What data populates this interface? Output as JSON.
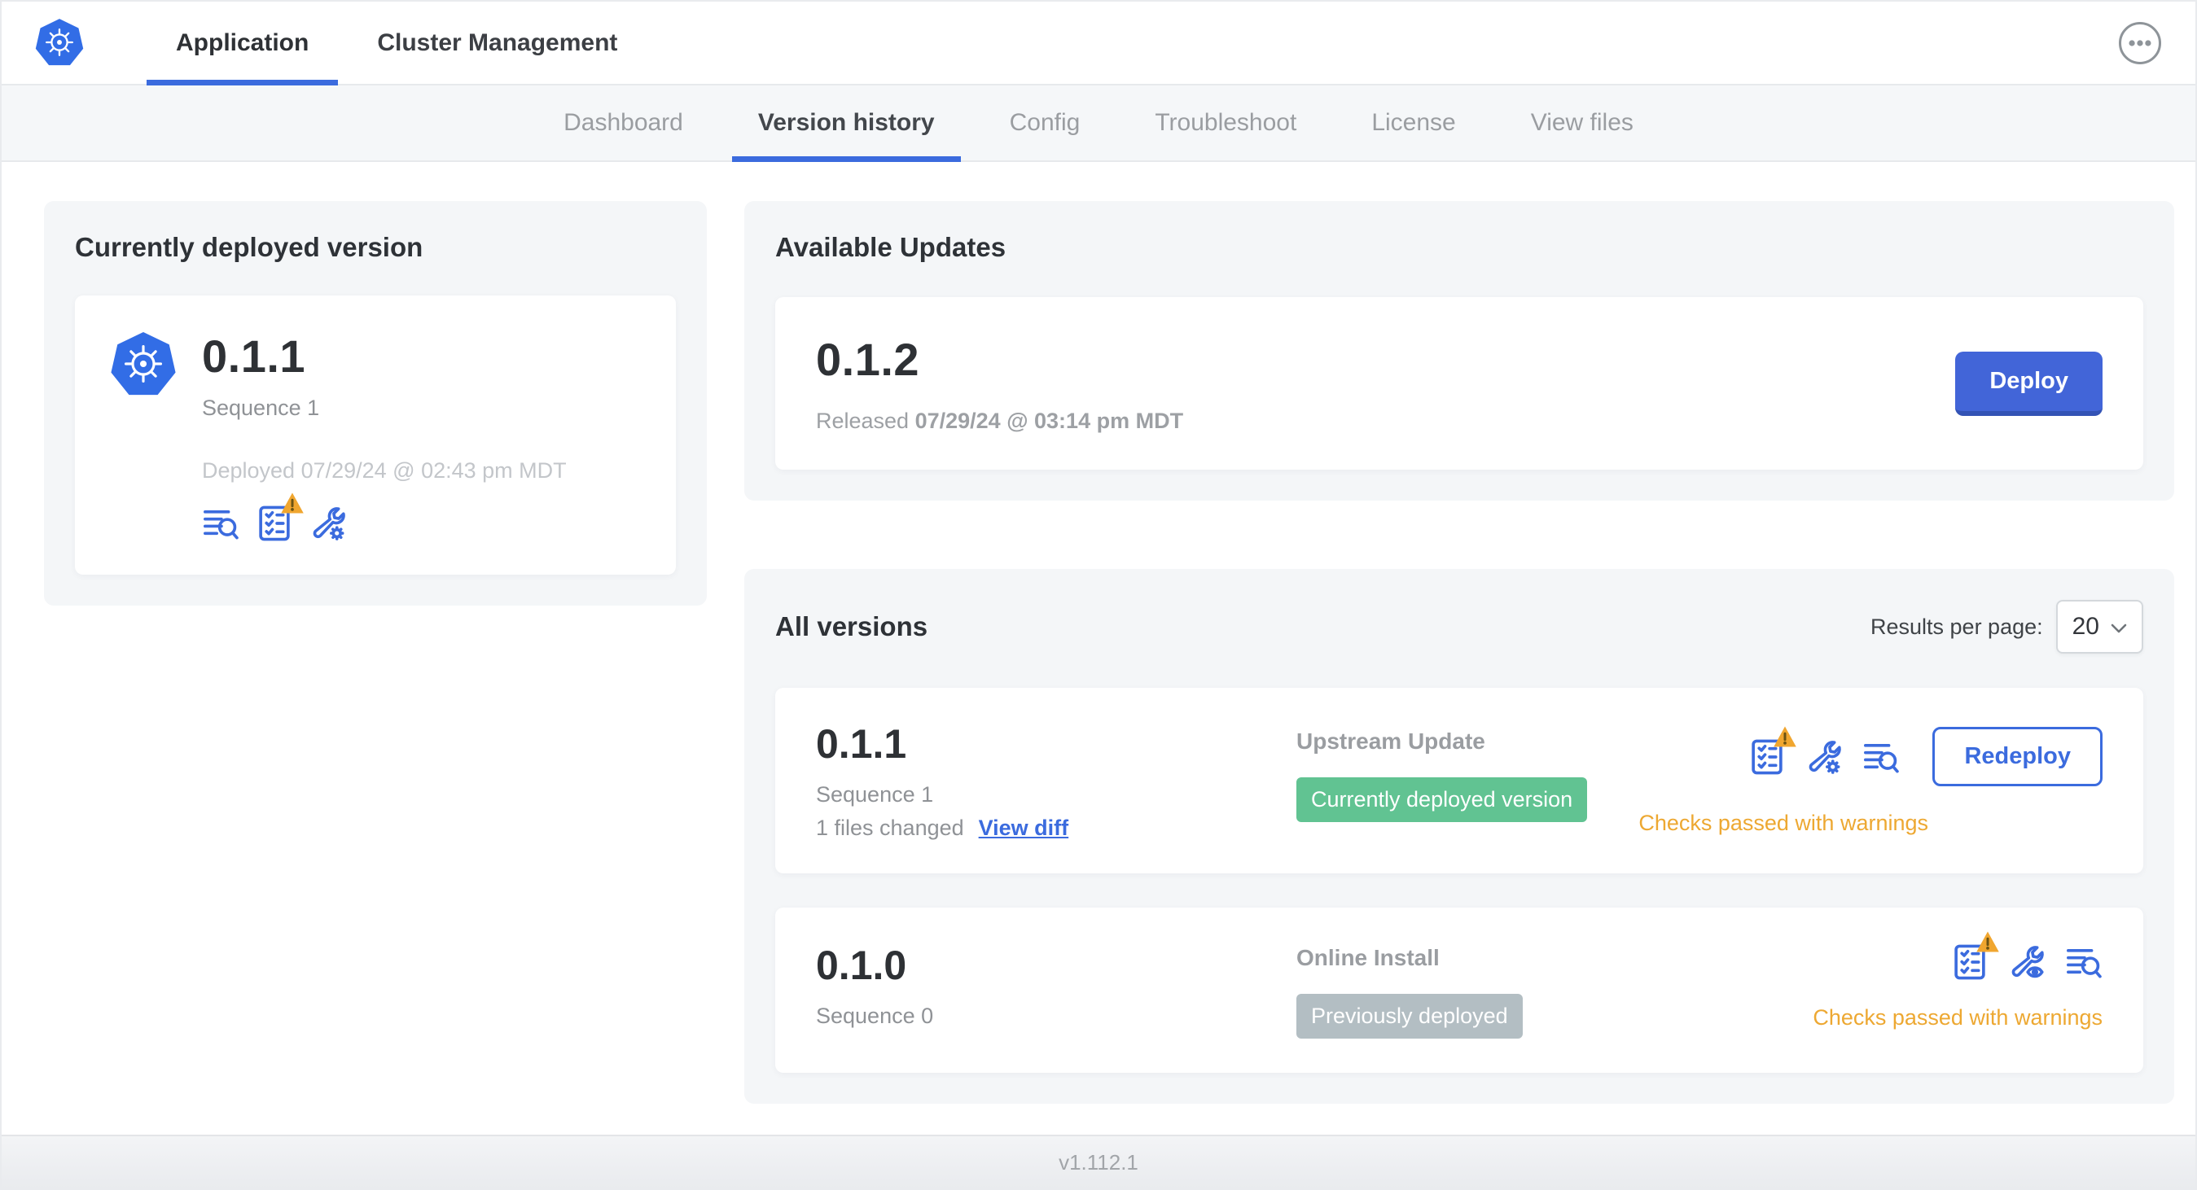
{
  "topbar": {
    "tabs": [
      {
        "label": "Application",
        "active": true
      },
      {
        "label": "Cluster Management",
        "active": false
      }
    ],
    "overflow_menu_icon": "ellipsis-icon"
  },
  "subnav": {
    "tabs": [
      {
        "label": "Dashboard",
        "active": false
      },
      {
        "label": "Version history",
        "active": true
      },
      {
        "label": "Config",
        "active": false
      },
      {
        "label": "Troubleshoot",
        "active": false
      },
      {
        "label": "License",
        "active": false
      },
      {
        "label": "View files",
        "active": false
      }
    ]
  },
  "current": {
    "title": "Currently deployed version",
    "logo_icon": "kubernetes-logo",
    "version": "0.1.1",
    "sequence": "Sequence 1",
    "deployed": "Deployed 07/29/24 @ 02:43 pm MDT",
    "icons": [
      "release-notes-icon",
      "preflight-checks-warning-icon",
      "config-icon"
    ]
  },
  "updates": {
    "title": "Available Updates",
    "items": [
      {
        "version": "0.1.2",
        "released_prefix": "Released",
        "released_date": "07/29/24 @ 03:14 pm MDT",
        "action_label": "Deploy"
      }
    ]
  },
  "versions": {
    "title": "All versions",
    "results_per_page_label": "Results per page:",
    "results_per_page_value": "20",
    "rows": [
      {
        "version": "0.1.1",
        "sequence": "Sequence 1",
        "files_changed": "1 files changed",
        "view_diff_label": "View diff",
        "source": "Upstream Update",
        "badge": "Currently deployed version",
        "badge_color": "#61c392",
        "icons": [
          "preflight-checks-warning-icon",
          "config-icon",
          "release-notes-icon"
        ],
        "action_label": "Redeploy",
        "checks": "Checks passed with warnings"
      },
      {
        "version": "0.1.0",
        "sequence": "Sequence 0",
        "source": "Online Install",
        "badge": "Previously deployed",
        "badge_color": "#b3bec3",
        "icons": [
          "preflight-checks-warning-icon",
          "view-config-icon",
          "release-notes-icon"
        ],
        "checks": "Checks passed with warnings"
      }
    ]
  },
  "footer": {
    "app_version": "v1.112.1"
  },
  "theme": {
    "primary_blue": "#3b6bde",
    "button_blue": "#4265d8",
    "kubernetes_blue": "#326de6",
    "warning_orange": "#eda832",
    "green_badge": "#61c392",
    "gray_badge": "#b3bec3",
    "section_bg": "#f4f6f8"
  }
}
